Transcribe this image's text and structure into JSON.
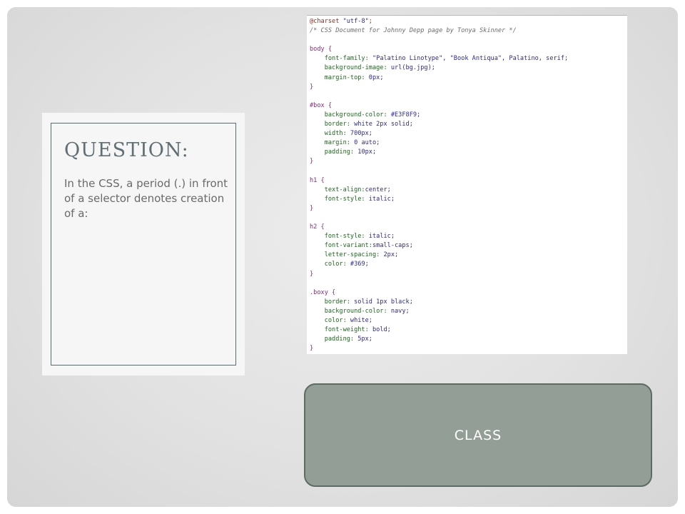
{
  "question": {
    "title": "QUESTION:",
    "body": "In the CSS, a period (.) in front of a selector denotes creation of a:"
  },
  "code_lines": [
    {
      "parts": [
        {
          "t": "@charset ",
          "c": "at"
        },
        {
          "t": "\"utf-8\"",
          "c": "str"
        },
        {
          "t": ";",
          "c": "at"
        }
      ]
    },
    {
      "parts": [
        {
          "t": "/* CSS Document for Johnny Depp page by Tonya Skinner */",
          "c": "cmt"
        }
      ]
    },
    {
      "parts": []
    },
    {
      "parts": [
        {
          "t": "body {",
          "c": "sel"
        }
      ]
    },
    {
      "parts": [
        {
          "t": "    font-family: ",
          "c": "prop"
        },
        {
          "t": "\"Palatino Linotype\", \"Book Antiqua\", Palatino, serif;",
          "c": "val"
        }
      ]
    },
    {
      "parts": [
        {
          "t": "    background-image: ",
          "c": "prop"
        },
        {
          "t": "url(bg.jpg);",
          "c": "val"
        }
      ]
    },
    {
      "parts": [
        {
          "t": "    margin-top: ",
          "c": "prop"
        },
        {
          "t": "0px;",
          "c": "val"
        }
      ]
    },
    {
      "parts": [
        {
          "t": "}",
          "c": "brace"
        }
      ]
    },
    {
      "parts": []
    },
    {
      "parts": [
        {
          "t": "#box {",
          "c": "sel"
        }
      ]
    },
    {
      "parts": [
        {
          "t": "    background-color: ",
          "c": "prop"
        },
        {
          "t": "#E3F8F9;",
          "c": "val"
        }
      ]
    },
    {
      "parts": [
        {
          "t": "    border: ",
          "c": "prop"
        },
        {
          "t": "white 2px solid;",
          "c": "val"
        }
      ]
    },
    {
      "parts": [
        {
          "t": "    width: ",
          "c": "prop"
        },
        {
          "t": "700px;",
          "c": "val"
        }
      ]
    },
    {
      "parts": [
        {
          "t": "    margin: ",
          "c": "prop"
        },
        {
          "t": "0 auto;",
          "c": "val"
        }
      ]
    },
    {
      "parts": [
        {
          "t": "    padding: ",
          "c": "prop"
        },
        {
          "t": "10px;",
          "c": "val"
        }
      ]
    },
    {
      "parts": [
        {
          "t": "}",
          "c": "brace"
        }
      ]
    },
    {
      "parts": []
    },
    {
      "parts": [
        {
          "t": "h1 {",
          "c": "sel"
        }
      ]
    },
    {
      "parts": [
        {
          "t": "    text-align:",
          "c": "prop"
        },
        {
          "t": "center;",
          "c": "val"
        }
      ]
    },
    {
      "parts": [
        {
          "t": "    font-style: ",
          "c": "prop"
        },
        {
          "t": "italic;",
          "c": "val"
        }
      ]
    },
    {
      "parts": [
        {
          "t": "}",
          "c": "brace"
        }
      ]
    },
    {
      "parts": []
    },
    {
      "parts": [
        {
          "t": "h2 {",
          "c": "sel"
        }
      ]
    },
    {
      "parts": [
        {
          "t": "    font-style: ",
          "c": "prop"
        },
        {
          "t": "italic;",
          "c": "val"
        }
      ]
    },
    {
      "parts": [
        {
          "t": "    font-variant:",
          "c": "prop"
        },
        {
          "t": "small-caps;",
          "c": "val"
        }
      ]
    },
    {
      "parts": [
        {
          "t": "    letter-spacing: ",
          "c": "prop"
        },
        {
          "t": "2px;",
          "c": "val"
        }
      ]
    },
    {
      "parts": [
        {
          "t": "    color: ",
          "c": "prop"
        },
        {
          "t": "#369;",
          "c": "val"
        }
      ]
    },
    {
      "parts": [
        {
          "t": "}",
          "c": "brace"
        }
      ]
    },
    {
      "parts": []
    },
    {
      "parts": [
        {
          "t": ".boxy {",
          "c": "sel"
        }
      ]
    },
    {
      "parts": [
        {
          "t": "    border: ",
          "c": "prop"
        },
        {
          "t": "solid 1px black;",
          "c": "val"
        }
      ]
    },
    {
      "parts": [
        {
          "t": "    background-color: ",
          "c": "prop"
        },
        {
          "t": "navy;",
          "c": "val"
        }
      ]
    },
    {
      "parts": [
        {
          "t": "    color: ",
          "c": "prop"
        },
        {
          "t": "white;",
          "c": "val"
        }
      ]
    },
    {
      "parts": [
        {
          "t": "    font-weight: ",
          "c": "prop"
        },
        {
          "t": "bold;",
          "c": "val"
        }
      ]
    },
    {
      "parts": [
        {
          "t": "    padding: ",
          "c": "prop"
        },
        {
          "t": "5px;",
          "c": "val"
        }
      ]
    },
    {
      "parts": [
        {
          "t": "}",
          "c": "brace"
        }
      ]
    }
  ],
  "answer": {
    "label": "CLASS"
  },
  "colors": {
    "answer_fill": "#939f96",
    "title_text": "#5f6f73"
  }
}
